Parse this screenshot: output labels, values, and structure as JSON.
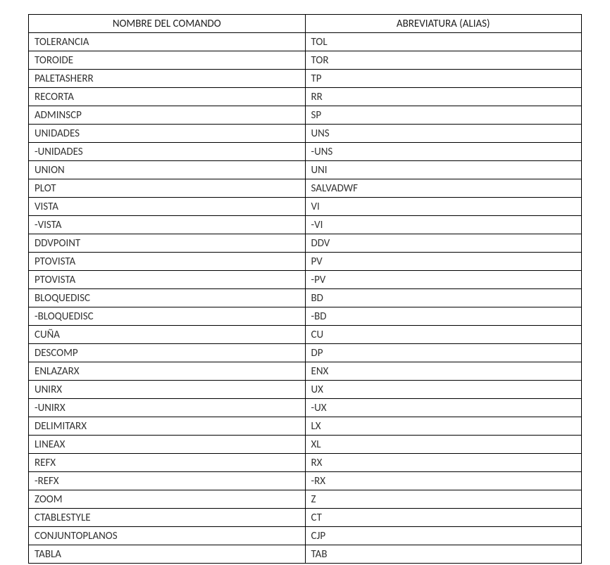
{
  "chart_data": {
    "type": "table",
    "headers": [
      "NOMBRE DEL COMANDO",
      "ABREVIATURA (ALIAS)"
    ],
    "rows": [
      {
        "comando": "TOLERANCIA",
        "alias": "TOL"
      },
      {
        "comando": "TOROIDE",
        "alias": "TOR"
      },
      {
        "comando": "PALETASHERR",
        "alias": "TP"
      },
      {
        "comando": "RECORTA",
        "alias": "RR"
      },
      {
        "comando": "ADMINSCP",
        "alias": "SP"
      },
      {
        "comando": "UNIDADES",
        "alias": "UNS"
      },
      {
        "comando": "-UNIDADES",
        "alias": "-UNS"
      },
      {
        "comando": "UNION",
        "alias": "UNI"
      },
      {
        "comando": "PLOT",
        "alias": "SALVADWF"
      },
      {
        "comando": "VISTA",
        "alias": "VI"
      },
      {
        "comando": "-VISTA",
        "alias": "-VI"
      },
      {
        "comando": "DDVPOINT",
        "alias": "DDV"
      },
      {
        "comando": "PTOVISTA",
        "alias": "PV"
      },
      {
        "comando": "PTOVISTA",
        "alias": "-PV"
      },
      {
        "comando": "BLOQUEDISC",
        "alias": "BD"
      },
      {
        "comando": "-BLOQUEDISC",
        "alias": "-BD"
      },
      {
        "comando": "CUÑA",
        "alias": "CU"
      },
      {
        "comando": "DESCOMP",
        "alias": "DP"
      },
      {
        "comando": "ENLAZARX",
        "alias": "ENX"
      },
      {
        "comando": "UNIRX",
        "alias": "UX"
      },
      {
        "comando": "-UNIRX",
        "alias": "-UX"
      },
      {
        "comando": "DELIMITARX",
        "alias": "LX"
      },
      {
        "comando": "LINEAX",
        "alias": "XL"
      },
      {
        "comando": "REFX",
        "alias": "RX"
      },
      {
        "comando": "-REFX",
        "alias": "-RX"
      },
      {
        "comando": "ZOOM",
        "alias": "Z"
      },
      {
        "comando": "CTABLESTYLE",
        "alias": "CT"
      },
      {
        "comando": "CONJUNTOPLANOS",
        "alias": "CJP"
      },
      {
        "comando": "TABLA",
        "alias": "TAB"
      }
    ]
  }
}
